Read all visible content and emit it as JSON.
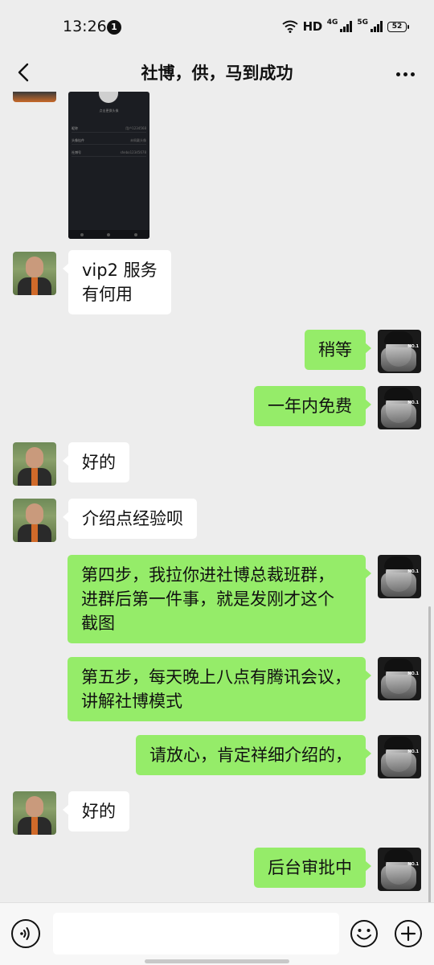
{
  "status_bar": {
    "time": "13:26",
    "notification_count": "1",
    "hd_label": "HD",
    "net1": "4G",
    "net2": "5G",
    "battery": "52"
  },
  "header": {
    "title": "社博，供，马到成功",
    "back_icon": "chevron-left-icon",
    "more_icon": "more-dots-icon"
  },
  "shared_image": {
    "caption": "点击更换头像",
    "rows": [
      {
        "label": "昵称",
        "value": "用户1234568"
      },
      {
        "label": "头像挂件",
        "value": "未佩戴头像"
      },
      {
        "label": "社博号",
        "value": "shebo12345678"
      }
    ]
  },
  "messages": [
    {
      "side": "in",
      "text": "vip2 服务\n有何用"
    },
    {
      "side": "out",
      "text": "稍等"
    },
    {
      "side": "out",
      "text": "一年内免费"
    },
    {
      "side": "in",
      "text": "好的"
    },
    {
      "side": "in",
      "text": "介绍点经验呗"
    },
    {
      "side": "out",
      "text": "第四步，我拉你进社博总裁班群，\n进群后第一件事，就是发刚才这个\n截图"
    },
    {
      "side": "out",
      "text": "第五步，每天晚上八点有腾讯会议，\n讲解社博模式"
    },
    {
      "side": "out",
      "text": "请放心，肯定祥细介绍的，"
    },
    {
      "side": "in",
      "text": "好的"
    },
    {
      "side": "out",
      "text": "后台审批中"
    }
  ],
  "avatar_right_text": "NO.1",
  "input_bar": {
    "placeholder": "",
    "voice_icon": "voice-icon",
    "emoji_icon": "emoji-icon",
    "plus_icon": "plus-icon"
  },
  "colors": {
    "background": "#ededed",
    "outgoing_bubble": "#95ec69",
    "incoming_bubble": "#ffffff"
  }
}
